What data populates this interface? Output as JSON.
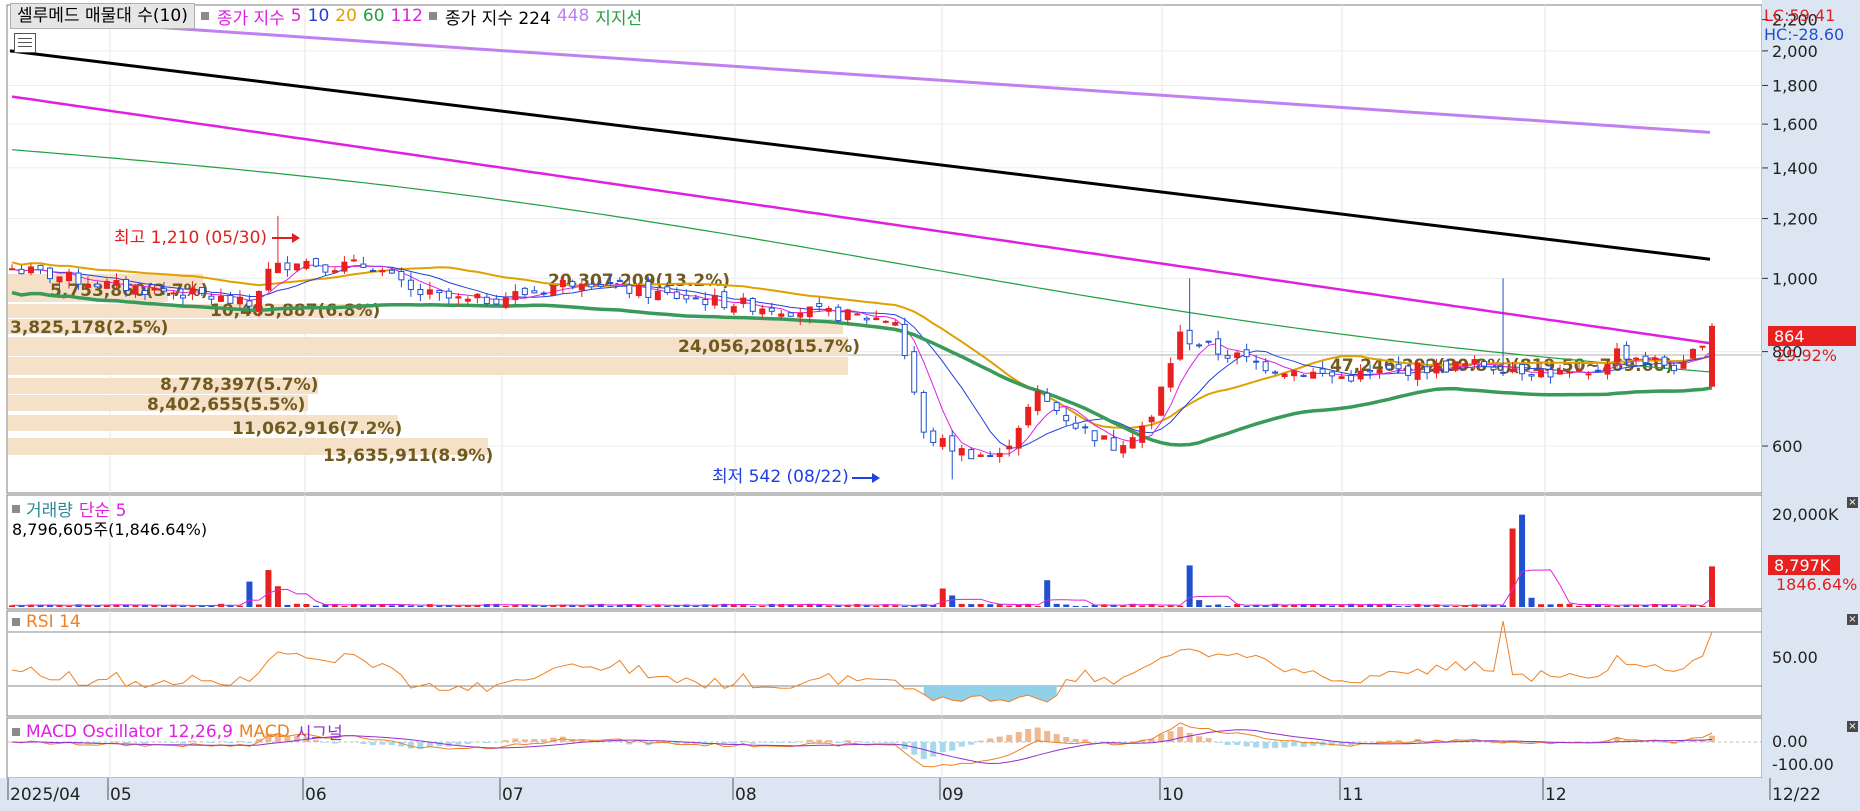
{
  "header": {
    "selector_label": "셀루메드 매물대 수(10)",
    "ma_label": "종가 지수",
    "ma_periods": [
      {
        "v": "5",
        "color": "#e020e0"
      },
      {
        "v": "10",
        "color": "#2040e0"
      },
      {
        "v": "20",
        "color": "#e0a000"
      },
      {
        "v": "60",
        "color": "#20a040"
      },
      {
        "v": "112",
        "color": "#e020e0"
      }
    ],
    "ma2_label": "종가 지수 224",
    "ma2_extra": "448",
    "support_label": "지지선",
    "lc": "LC:59.41",
    "hc": "HC:-28.60"
  },
  "price_panel": {
    "y_axis_ticks": [
      "2,200",
      "2,000",
      "1,800",
      "1,600",
      "1,400",
      "1,200",
      "1,000",
      "800",
      "600"
    ],
    "current_price": "864",
    "current_change": "29.92%",
    "high_marker": "최고 1,210 (05/30)",
    "low_marker": "최저 542 (08/22)",
    "volume_profile_labels": [
      "5,753,860(3.7%)",
      "10,403,887(6.8%)",
      "3,825,178(2.5%)",
      "20,307,209(13.2%)",
      "24,056,208(15.7%)",
      "8,778,397(5.7%)",
      "8,402,655(5.5%)",
      "11,062,916(7.2%)",
      "13,635,911(8.9%)",
      "47,246,292(30.8%)(819.50~769.60)"
    ]
  },
  "volume_panel": {
    "title": "거래량",
    "ma_label": "단순 5",
    "info": "8,796,605주(1,846.64%)",
    "y_axis_ticks": [
      "20,000K"
    ],
    "current_value": "8,797K",
    "current_change": "1846.64%"
  },
  "rsi_panel": {
    "title": "RSI 14",
    "y_axis_ticks": [
      "50.00"
    ]
  },
  "macd_panel": {
    "title": "MACD Oscillator 12,26,9",
    "macd_label": "MACD",
    "signal_label": "시그널",
    "y_axis_ticks": [
      "0.00",
      "-100.00"
    ]
  },
  "x_axis": {
    "labels": [
      "2025/04",
      "05",
      "06",
      "07",
      "08",
      "09",
      "10",
      "11",
      "12",
      "12/22"
    ]
  },
  "colors": {
    "up": "#e82020",
    "down": "#2050d0",
    "ma5": "#e020e0",
    "ma10": "#2040e0",
    "ma20": "#e0a000",
    "ma60": "#20a040",
    "ma112": "#e020e0",
    "ma224": "#000000",
    "ma448": "#c080f0",
    "support": "#3a9a5a",
    "volume_profile": "#f5e0c8",
    "rsi": "#f08020",
    "axis_bg": "#dce6f2"
  },
  "chart_data": {
    "type": "candlestick",
    "x_range": [
      "2025/04",
      "2025/12/22"
    ],
    "price_ylim": [
      520,
      2300
    ],
    "y_scale": "log",
    "months": [
      "2025/04",
      "05",
      "06",
      "07",
      "08",
      "09",
      "10",
      "11",
      "12"
    ],
    "last_close": 864,
    "high": {
      "value": 1210,
      "date": "05/30"
    },
    "low": {
      "value": 542,
      "date": "08/22"
    },
    "moving_averages": {
      "ma224": {
        "start": 2000,
        "end": 1060
      },
      "ma448": {
        "start": 2150,
        "end": 1560
      },
      "ma112": {
        "start": 1740,
        "end": 820
      },
      "ma60": {
        "start": 1480,
        "end": 760
      }
    },
    "volume_ylim": [
      0,
      21000
    ],
    "volume_last": 8797,
    "rsi_ylim": [
      0,
      100
    ],
    "rsi_levels": [
      30,
      50,
      70
    ],
    "macd_ylim": [
      -120,
      40
    ]
  }
}
